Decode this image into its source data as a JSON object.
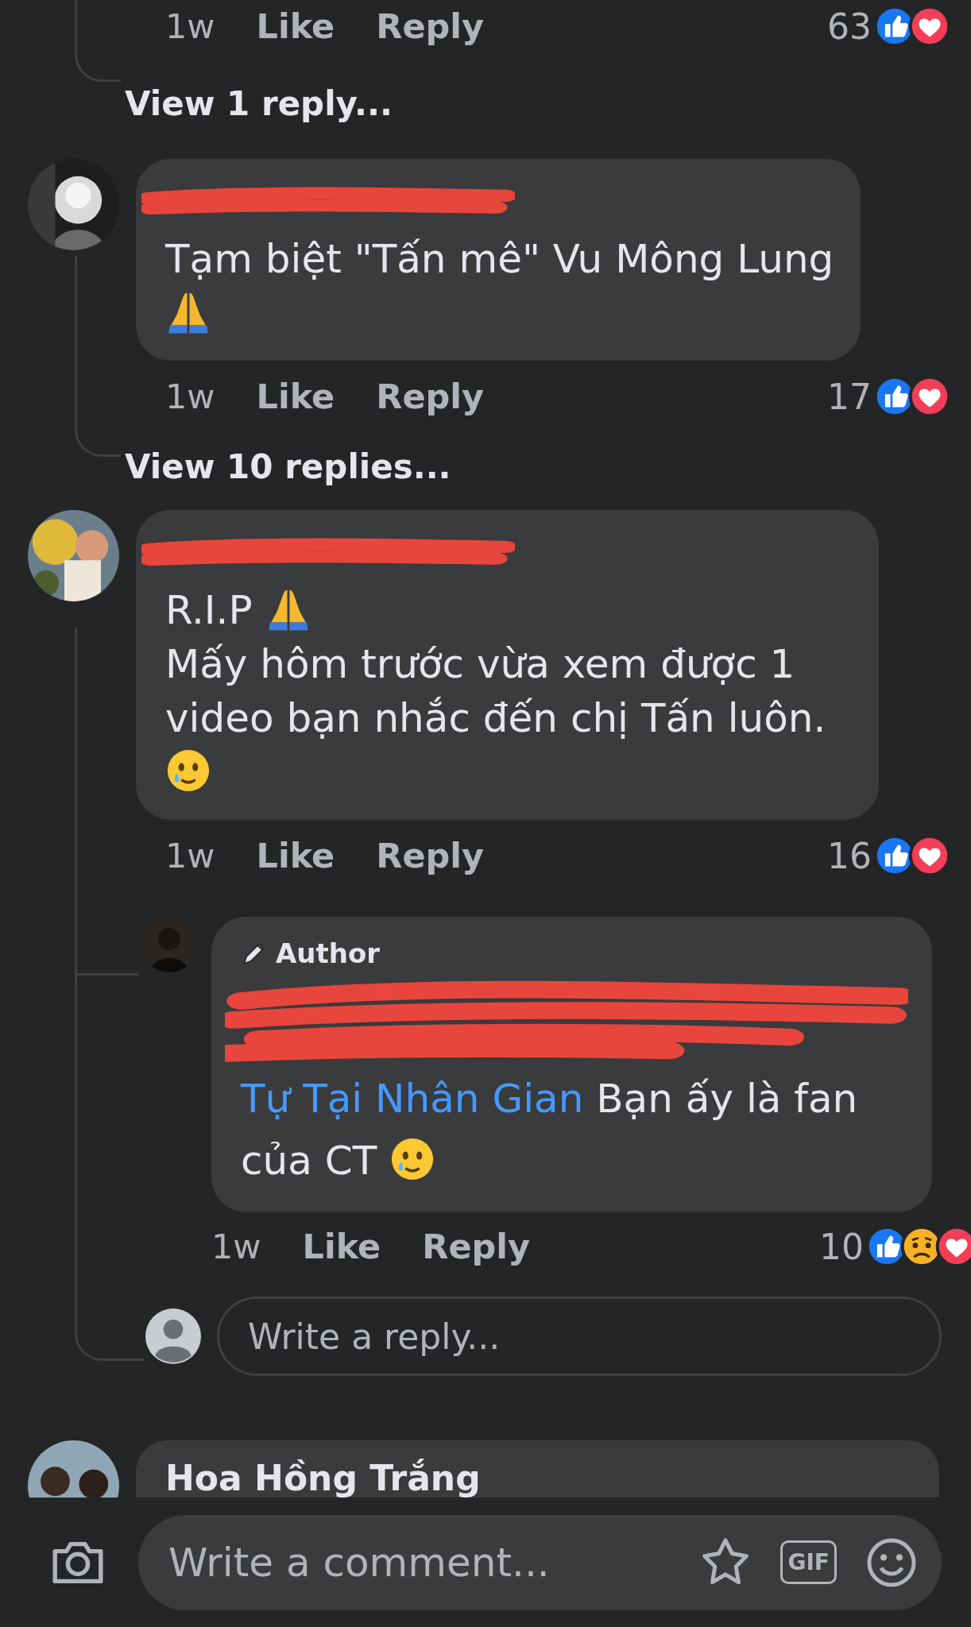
{
  "previous_comment": {
    "time": "1w",
    "like": "Like",
    "reply": "Reply",
    "reaction_count": "63",
    "reactions": [
      {
        "kind": "like"
      },
      {
        "kind": "love"
      }
    ]
  },
  "view_replies_link": "View 1 reply...",
  "comments": [
    {
      "name_redacted": true,
      "lines": [
        [
          {
            "kind": "text",
            "text": "Tạm biệt \"Tấn mê\" Vu Mông Lung"
          }
        ],
        [
          {
            "kind": "pray"
          }
        ]
      ],
      "time": "1w",
      "like": "Like",
      "reply": "Reply",
      "reaction_count": "17",
      "reactions": [
        {
          "kind": "like"
        },
        {
          "kind": "love"
        }
      ],
      "view_replies": "View 10 replies..."
    },
    {
      "name_redacted": true,
      "lines": [
        [
          {
            "kind": "text",
            "text": "R.I.P "
          },
          {
            "kind": "pray"
          }
        ],
        [
          {
            "kind": "text",
            "text": "Mấy hôm trước vừa xem được 1 video bạn nhắc đến chị Tấn luôn."
          }
        ],
        [
          {
            "kind": "tear-smile"
          }
        ]
      ],
      "time": "1w",
      "like": "Like",
      "reply": "Reply",
      "reaction_count": "16",
      "reactions": [
        {
          "kind": "like"
        },
        {
          "kind": "love"
        }
      ],
      "replies": [
        {
          "author_badge": "Author",
          "name_redacted": true,
          "lines": [
            [
              {
                "kind": "mention",
                "text": "Tự Tại Nhân Gian"
              },
              {
                "kind": "text",
                "text": " Bạn ấy là fan của CT "
              },
              {
                "kind": "tear-smile"
              }
            ]
          ],
          "time": "1w",
          "like": "Like",
          "reply": "Reply",
          "reaction_count": "10",
          "reactions": [
            {
              "kind": "like"
            },
            {
              "kind": "sad"
            },
            {
              "kind": "love"
            }
          ]
        }
      ],
      "reply_field": {
        "placeholder": "Write a reply..."
      }
    }
  ],
  "next_comment": {
    "name": "Hoa Hồng Trắng"
  },
  "composer": {
    "placeholder": "Write a comment...",
    "gif_label": "GIF"
  }
}
